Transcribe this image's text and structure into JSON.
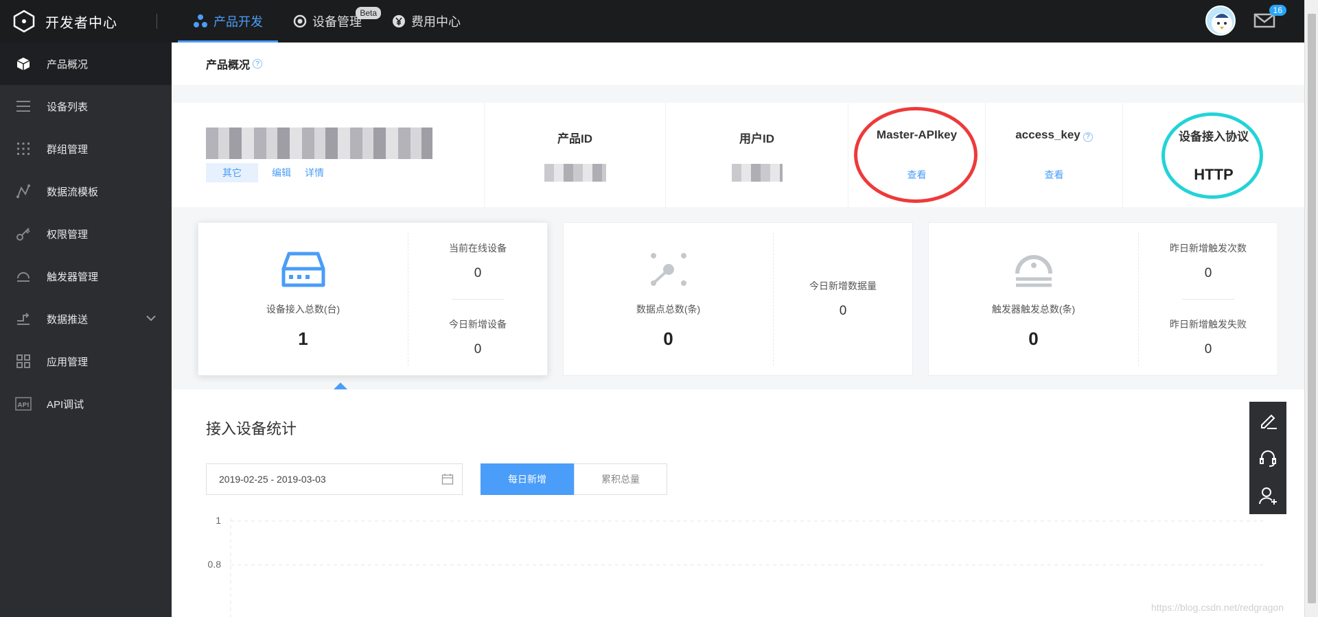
{
  "header": {
    "app_title": "开发者中心",
    "nav": [
      {
        "label": "产品开发",
        "active": true
      },
      {
        "label": "设备管理",
        "badge": "Beta"
      },
      {
        "label": "费用中心"
      }
    ],
    "mail_count": "16",
    "accent_color": "#4a9df8"
  },
  "sidebar": {
    "items": [
      {
        "label": "产品概况",
        "icon": "cube-icon",
        "active": true
      },
      {
        "label": "设备列表",
        "icon": "list-icon"
      },
      {
        "label": "群组管理",
        "icon": "grid-dots-icon"
      },
      {
        "label": "数据流模板",
        "icon": "data-stream-icon"
      },
      {
        "label": "权限管理",
        "icon": "key-icon"
      },
      {
        "label": "触发器管理",
        "icon": "trigger-icon"
      },
      {
        "label": "数据推送",
        "icon": "push-icon",
        "expandable": true
      },
      {
        "label": "应用管理",
        "icon": "apps-icon"
      },
      {
        "label": "API调试",
        "icon": "api-icon"
      }
    ]
  },
  "page": {
    "title": "产品概况"
  },
  "product": {
    "tag": "其它",
    "edit_link": "编辑",
    "detail_link": "详情",
    "fields": {
      "product_id_label": "产品ID",
      "user_id_label": "用户ID",
      "master_apikey_label": "Master-APIkey",
      "master_apikey_link": "查看",
      "access_key_label": "access_key",
      "access_key_link": "查看",
      "protocol_label": "设备接入协议",
      "protocol_value": "HTTP"
    }
  },
  "stats": [
    {
      "main_label": "设备接入总数(台)",
      "main_value": "1",
      "sub": [
        {
          "label": "当前在线设备",
          "value": "0"
        },
        {
          "label": "今日新增设备",
          "value": "0"
        }
      ]
    },
    {
      "main_label": "数据点总数(条)",
      "main_value": "0",
      "sub": [
        {
          "label": "今日新增数据量",
          "value": "0"
        }
      ]
    },
    {
      "main_label": "触发器触发总数(条)",
      "main_value": "0",
      "sub": [
        {
          "label": "昨日新增触发次数",
          "value": "0"
        },
        {
          "label": "昨日新增触发失败",
          "value": "0"
        }
      ]
    }
  ],
  "device_stats": {
    "title": "接入设备统计",
    "date_range": "2019-02-25 - 2019-03-03",
    "tabs": [
      {
        "label": "每日新增",
        "active": true
      },
      {
        "label": "累积总量"
      }
    ],
    "chart": {
      "y_ticks": [
        "1",
        "0.8"
      ]
    }
  },
  "watermark": "https://blog.csdn.net/redgragon"
}
